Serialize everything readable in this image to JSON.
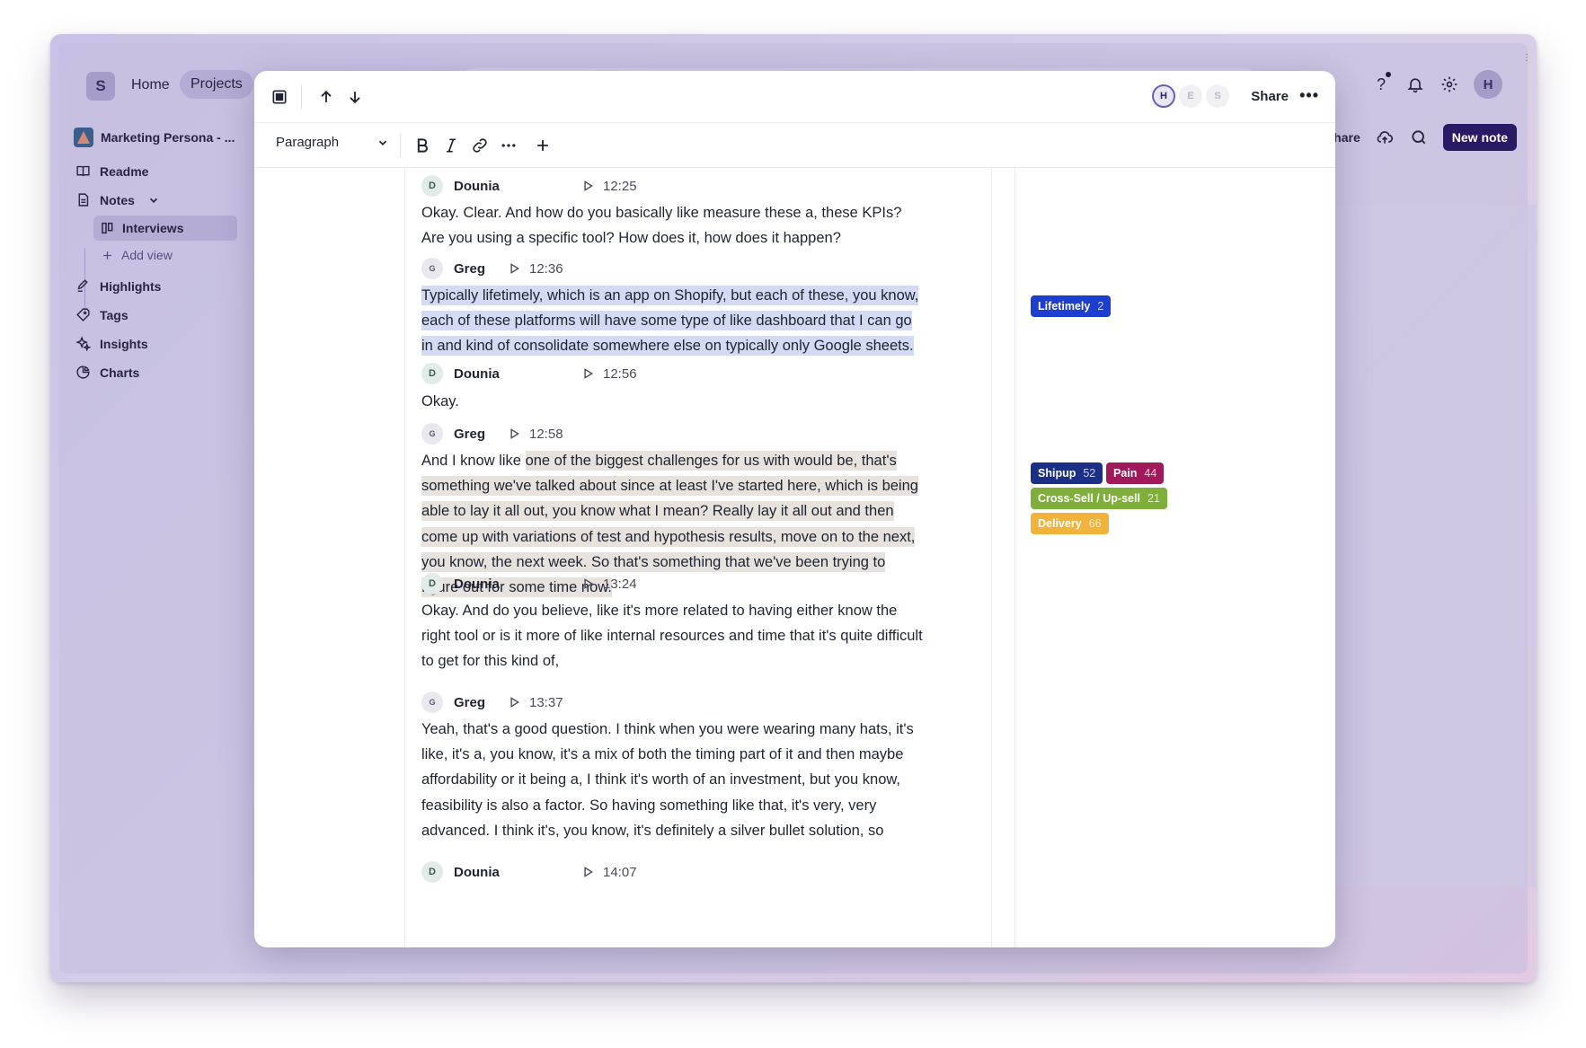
{
  "app": {
    "workspace_initial": "S",
    "nav": {
      "home": "Home",
      "projects": "Projects"
    },
    "user_initial": "H",
    "help": "?",
    "share_label": "Share",
    "new_note_label": "New note"
  },
  "sidebar": {
    "project_name": "Marketing Persona - ...",
    "items": [
      {
        "label": "Readme",
        "icon": "book-icon"
      },
      {
        "label": "Notes",
        "icon": "note-icon"
      },
      {
        "label": "Interviews",
        "icon": "columns-icon"
      },
      {
        "label": "Add view",
        "icon": "plus-icon"
      },
      {
        "label": "Highlights",
        "icon": "highlighter-icon"
      },
      {
        "label": "Tags",
        "icon": "tag-icon"
      },
      {
        "label": "Insights",
        "icon": "sparkle-icon"
      },
      {
        "label": "Charts",
        "icon": "pie-chart-icon"
      }
    ]
  },
  "modal": {
    "presence": [
      "H",
      "E",
      "S"
    ],
    "share_label": "Share",
    "more_label": "•••",
    "toolbar": {
      "paragraph_style": "Paragraph"
    },
    "transcript": [
      {
        "speaker": "Dounia",
        "initial": "D",
        "time": "12:25"
      },
      {
        "text": "Okay. Clear. And how do you basically like measure these a, these KPIs? Are you using a specific tool? How does it, how does it happen?"
      },
      {
        "speaker": "Greg",
        "initial": "G",
        "time": "12:36"
      },
      {
        "text": "Typically lifetimely, which is an app on Shopify, but each of these, you know, each of these platforms will have some type of like dashboard that I can go in and kind of consolidate somewhere else on typically only Google sheets."
      },
      {
        "speaker": "Dounia",
        "initial": "D",
        "time": "12:56"
      },
      {
        "text": "Okay."
      },
      {
        "speaker": "Greg",
        "initial": "G",
        "time": "12:58"
      },
      {
        "text_prefix": "And I know like ",
        "text": "one of the biggest challenges for us with would be, that's something we've talked about since at least I've started here, which is being able to lay it all out, you know what I mean? Really lay it all out and then come up with variations of test and hypothesis results, move on to the next, you know, the next week. So that's something that we've been trying to figure out for some time now."
      },
      {
        "speaker": "Dounia",
        "initial": "D",
        "time": "13:24"
      },
      {
        "text": "Okay. And do you believe, like it's more related to having either know the right tool or is it more of like internal resources and time that it's quite difficult to get for this kind of,"
      },
      {
        "speaker": "Greg",
        "initial": "G",
        "time": "13:37"
      },
      {
        "text": "Yeah, that's a good question. I think when you were wearing many hats, it's like, it's a, you know, it's a mix of both the timing part of it and then maybe affordability or it being a, I think it's worth of an investment, but you know, feasibility is also a factor. So having something like that, it's very, very advanced. I think it's, you know, it's definitely a silver bullet solution, so"
      },
      {
        "speaker": "Dounia",
        "initial": "D",
        "time": "14:07"
      }
    ],
    "tags": [
      {
        "label": "Lifetimely",
        "count": "2",
        "color": "#1d3fcf"
      },
      {
        "label": "Shipup",
        "count": "52",
        "color": "#1b2f86"
      },
      {
        "label": "Pain",
        "count": "44",
        "color": "#a1195a"
      },
      {
        "label": "Cross-Sell / Up-sell",
        "count": "21",
        "color": "#7fae3a"
      },
      {
        "label": "Delivery",
        "count": "66",
        "color": "#f2b33a"
      }
    ]
  }
}
